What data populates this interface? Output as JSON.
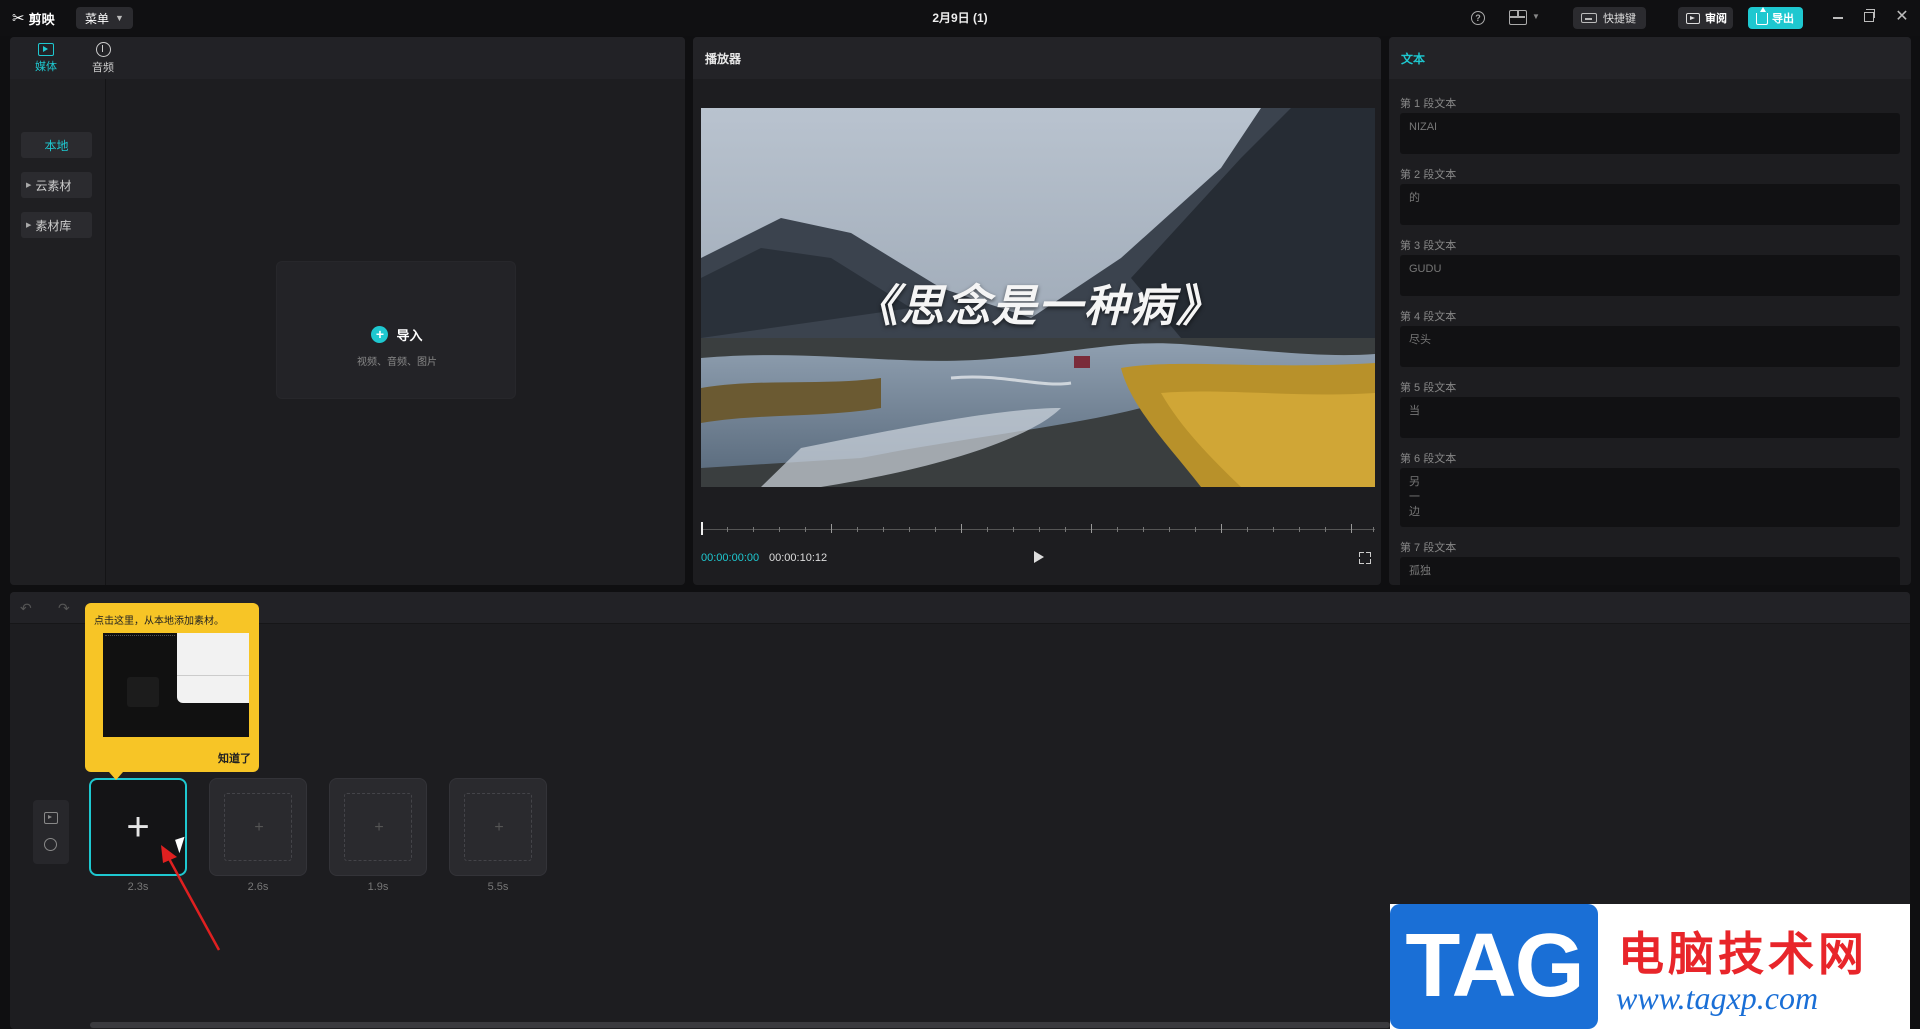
{
  "app": {
    "logo_text": "剪映",
    "menu_label": "菜单",
    "document_title": "2月9日 (1)",
    "shortcut_label": "快捷键",
    "review_label": "审阅",
    "export_label": "导出",
    "accent_color": "#1ec8d0"
  },
  "media": {
    "tabs": [
      {
        "label": "媒体",
        "icon": "media-icon",
        "active": true
      },
      {
        "label": "音频",
        "icon": "audio-icon",
        "active": false
      }
    ],
    "sidebar": [
      {
        "label": "本地",
        "active": true
      },
      {
        "label": "云素材",
        "active": false
      },
      {
        "label": "素材库",
        "active": false
      }
    ],
    "import_label": "导入",
    "import_hint": "视频、音频、图片"
  },
  "player": {
    "title": "播放器",
    "video_caption": "《思念是一种病》",
    "current_time": "00:00:00:00",
    "total_time": "00:00:10:12"
  },
  "text_panel": {
    "title": "文本",
    "segments": [
      {
        "label": "第 1 段文本",
        "value": "NIZAI"
      },
      {
        "label": "第 2 段文本",
        "value": "的"
      },
      {
        "label": "第 3 段文本",
        "value": "GUDU"
      },
      {
        "label": "第 4 段文本",
        "value": "尽头"
      },
      {
        "label": "第 5 段文本",
        "value": "当"
      },
      {
        "label": "第 6 段文本",
        "value": "另\n一\n边"
      },
      {
        "label": "第 7 段文本",
        "value": "孤独"
      }
    ]
  },
  "timeline": {
    "tooltip_text": "点击这里，从本地添加素材。",
    "tooltip_ok": "知道了",
    "slots": [
      {
        "duration": "2.3s",
        "active": true
      },
      {
        "duration": "2.6s",
        "active": false
      },
      {
        "duration": "1.9s",
        "active": false
      },
      {
        "duration": "5.5s",
        "active": false
      }
    ]
  },
  "watermark": {
    "tag": "TAG",
    "site_name": "电脑技术网",
    "url": "www.tagxp.com"
  }
}
